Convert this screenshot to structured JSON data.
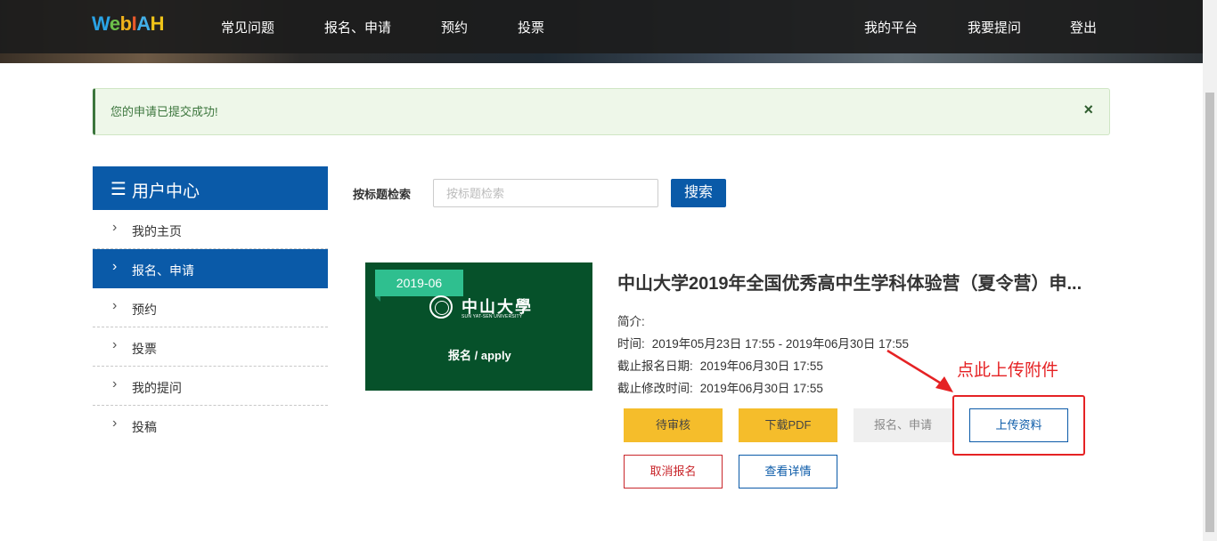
{
  "nav": {
    "logo": {
      "w": "W",
      "e": "e",
      "b": "b",
      "i": "I",
      "a": "A",
      "h": "H"
    },
    "items": [
      "常见问题",
      "报名、申请",
      "预约",
      "投票"
    ],
    "right_items": [
      "我的平台",
      "我要提问",
      "登出"
    ]
  },
  "alert": {
    "message": "您的申请已提交成功!",
    "close": "×"
  },
  "user_center": {
    "title": "用户中心",
    "menu_icon": "☰",
    "items": [
      {
        "label": "我的主页",
        "active": false
      },
      {
        "label": "报名、申请",
        "active": true
      },
      {
        "label": "预约",
        "active": false
      },
      {
        "label": "投票",
        "active": false
      },
      {
        "label": "我的提问",
        "active": false
      },
      {
        "label": "投稿",
        "active": false
      }
    ],
    "chevron": "›"
  },
  "search": {
    "label": "按标题检索",
    "placeholder": "按标题检索",
    "button": "搜索"
  },
  "item": {
    "date_tag": "2019-06",
    "image_title": "中山大學",
    "image_subtitle": "SUN YAT-SEN UNIVERSITY",
    "image_caption": "报名 / apply",
    "title": "中山大学2019年全国优秀高中生学科体验营（夏令营）申...",
    "intro_label": "简介:",
    "time_label": "时间:",
    "time_value": "2019年05月23日 17:55 - 2019年06月30日 17:55",
    "deadline_label": "截止报名日期:",
    "deadline_value": "2019年06月30日 17:55",
    "edit_deadline_label": "截止修改时间:",
    "edit_deadline_value": "2019年06月30日 17:55",
    "buttons": {
      "pending": "待审核",
      "download_pdf": "下载PDF",
      "apply": "报名、申请",
      "upload": "上传资料",
      "cancel": "取消报名",
      "details": "查看详情"
    }
  },
  "annotation": {
    "text": "点此上传附件",
    "color": "#e52224"
  },
  "colors": {
    "primary": "#0a5aa8",
    "warning": "#f5bd2b",
    "danger": "#c9262b",
    "success_text": "#3c763d",
    "tag": "#2fbf8f",
    "card_bg": "#06512a"
  }
}
